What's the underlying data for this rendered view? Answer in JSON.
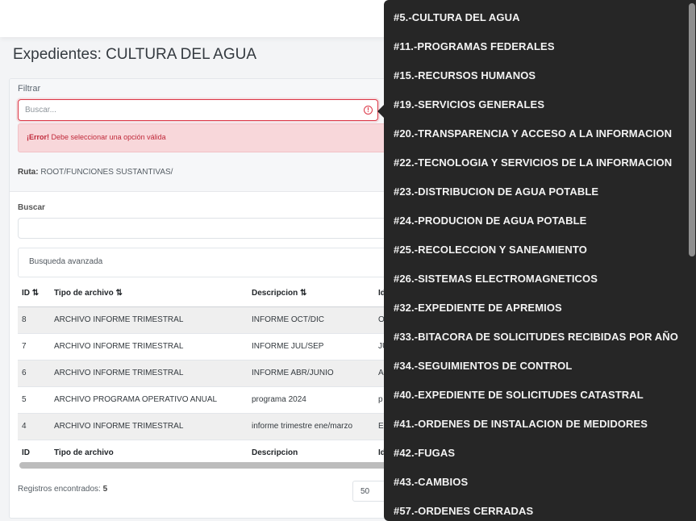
{
  "page": {
    "title": "Expedientes: CULTURA DEL AGUA"
  },
  "filter": {
    "label": "Filtrar",
    "search_placeholder": "Buscar...",
    "error_strong": "¡Error!",
    "error_message": "Debe seleccionar una opción válida",
    "ruta_label": "Ruta:",
    "ruta_value": "ROOT/FUNCIONES SUSTANTIVAS/"
  },
  "search": {
    "label": "Buscar",
    "advanced_label": "Busqueda avanzada"
  },
  "table": {
    "headers": [
      "ID ⇅",
      "Tipo de archivo ⇅",
      "Descripcion ⇅",
      "Id"
    ],
    "footer": [
      "ID",
      "Tipo de archivo",
      "Descripcion",
      "Id"
    ],
    "rows": [
      [
        "8",
        "ARCHIVO INFORME TRIMESTRAL",
        "INFORME OCT/DIC",
        "O"
      ],
      [
        "7",
        "ARCHIVO INFORME TRIMESTRAL",
        "INFORME JUL/SEP",
        "JU"
      ],
      [
        "6",
        "ARCHIVO INFORME TRIMESTRAL",
        "INFORME ABR/JUNIO",
        "A"
      ],
      [
        "5",
        "ARCHIVO PROGRAMA OPERATIVO ANUAL",
        "programa 2024",
        "p"
      ],
      [
        "4",
        "ARCHIVO INFORME TRIMESTRAL",
        "informe trimestre ene/marzo",
        "E"
      ]
    ]
  },
  "footer": {
    "registros_label": "Registros encontrados:",
    "registros_count": "5",
    "per_page": "50"
  },
  "dropdown": {
    "items": [
      "#5.-CULTURA DEL AGUA",
      "#11.-PROGRAMAS FEDERALES",
      "#15.-RECURSOS HUMANOS",
      "#19.-SERVICIOS GENERALES",
      "#20.-TRANSPARENCIA Y ACCESO A LA INFORMACION",
      "#22.-TECNOLOGIA Y SERVICIOS DE LA INFORMACION",
      "#23.-DISTRIBUCION DE AGUA POTABLE",
      "#24.-PRODUCION DE AGUA POTABLE",
      "#25.-RECOLECCION Y SANEAMIENTO",
      "#26.-SISTEMAS ELECTROMAGNETICOS",
      "#32.-EXPEDIENTE DE APREMIOS",
      "#33.-BITACORA DE SOLICITUDES RECIBIDAS POR AÑO",
      "#34.-SEGUIMIENTOS DE CONTROL",
      "#40.-EXPEDIENTE DE SOLICITUDES CATASTRAL",
      "#41.-ORDENES DE INSTALACION DE MEDIDORES",
      "#42.-FUGAS",
      "#43.-CAMBIOS",
      "#57.-ORDENES CERRADAS"
    ]
  }
}
